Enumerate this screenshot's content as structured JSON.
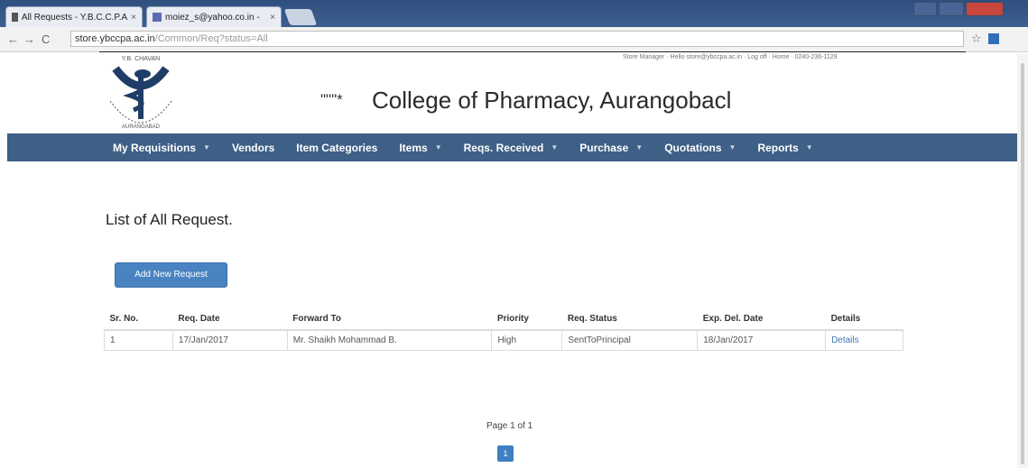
{
  "browser": {
    "tabs": [
      {
        "label": "All Requests - Y.B.C.C.P.A",
        "close": "×"
      },
      {
        "label": "moiez_s@yahoo.co.in -",
        "close": "×"
      }
    ],
    "back": "←",
    "forward": "→",
    "reload": "C",
    "url_host": "store.ybccpa.ac.in",
    "url_path": "/Common/Req?status=All",
    "star": "☆"
  },
  "header": {
    "top_links": "Store Manager  ·  Hello store@ybccpa.ac.in  ·  Log off  ·  Home  ·  0240-236-1129",
    "logo_top": "Y.B. CHAVAN",
    "logo_bottom": "AURANGABAD",
    "mark": "\"\"\"*",
    "college_name": "College of Pharmacy, Aurangobacl"
  },
  "nav": {
    "items": [
      {
        "label": "My Requisitions",
        "dropdown": true
      },
      {
        "label": "Vendors",
        "dropdown": false
      },
      {
        "label": "Item Categories",
        "dropdown": false
      },
      {
        "label": "Items",
        "dropdown": true
      },
      {
        "label": "Reqs. Received",
        "dropdown": true
      },
      {
        "label": "Purchase",
        "dropdown": true
      },
      {
        "label": "Quotations",
        "dropdown": true
      },
      {
        "label": "Reports",
        "dropdown": true
      }
    ],
    "caret": "▼"
  },
  "content": {
    "title": "List of All Request.",
    "add_button": "Add New Request",
    "table": {
      "headers": [
        "Sr. No.",
        "Req. Date",
        "Forward To",
        "Priority",
        "Req. Status",
        "Exp. Del. Date",
        "Details"
      ],
      "rows": [
        [
          "1",
          "17/Jan/2017",
          "Mr. Shaikh Mohammad B.",
          "High",
          "SentToPrincipal",
          "18/Jan/2017",
          "Details"
        ]
      ]
    },
    "page_info": "Page 1 of 1",
    "current_page": "1"
  },
  "colors": {
    "navbar": "#3e5f86",
    "button": "#4a83c1",
    "link": "#3d7ab8"
  }
}
